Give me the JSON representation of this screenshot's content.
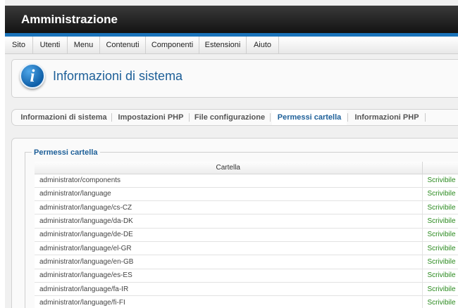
{
  "header": {
    "title": "Amministrazione"
  },
  "menu": [
    "Sito",
    "Utenti",
    "Menu",
    "Contenuti",
    "Componenti",
    "Estensioni",
    "Aiuto"
  ],
  "toolbar": {
    "icon": "info-icon",
    "title": "Informazioni di sistema"
  },
  "tabs": [
    {
      "label": "Informazioni di sistema",
      "active": false
    },
    {
      "label": "Impostazioni PHP",
      "active": false
    },
    {
      "label": "File configurazione",
      "active": false
    },
    {
      "label": "Permessi cartella",
      "active": true
    },
    {
      "label": "Informazioni PHP",
      "active": false
    }
  ],
  "panel": {
    "legend": "Permessi cartella",
    "table": {
      "columns": [
        "Cartella",
        ""
      ],
      "rows": [
        {
          "path": "administrator/components",
          "status": "Scrivibile"
        },
        {
          "path": "administrator/language",
          "status": "Scrivibile"
        },
        {
          "path": "administrator/language/cs-CZ",
          "status": "Scrivibile"
        },
        {
          "path": "administrator/language/da-DK",
          "status": "Scrivibile"
        },
        {
          "path": "administrator/language/de-DE",
          "status": "Scrivibile"
        },
        {
          "path": "administrator/language/el-GR",
          "status": "Scrivibile"
        },
        {
          "path": "administrator/language/en-GB",
          "status": "Scrivibile"
        },
        {
          "path": "administrator/language/es-ES",
          "status": "Scrivibile"
        },
        {
          "path": "administrator/language/fa-IR",
          "status": "Scrivibile"
        },
        {
          "path": "administrator/language/fi-FI",
          "status": "Scrivibile"
        }
      ]
    }
  },
  "colors": {
    "accent": "#1d5f98",
    "header_bar": "#1a73ba",
    "writable": "#2a8a1e"
  }
}
